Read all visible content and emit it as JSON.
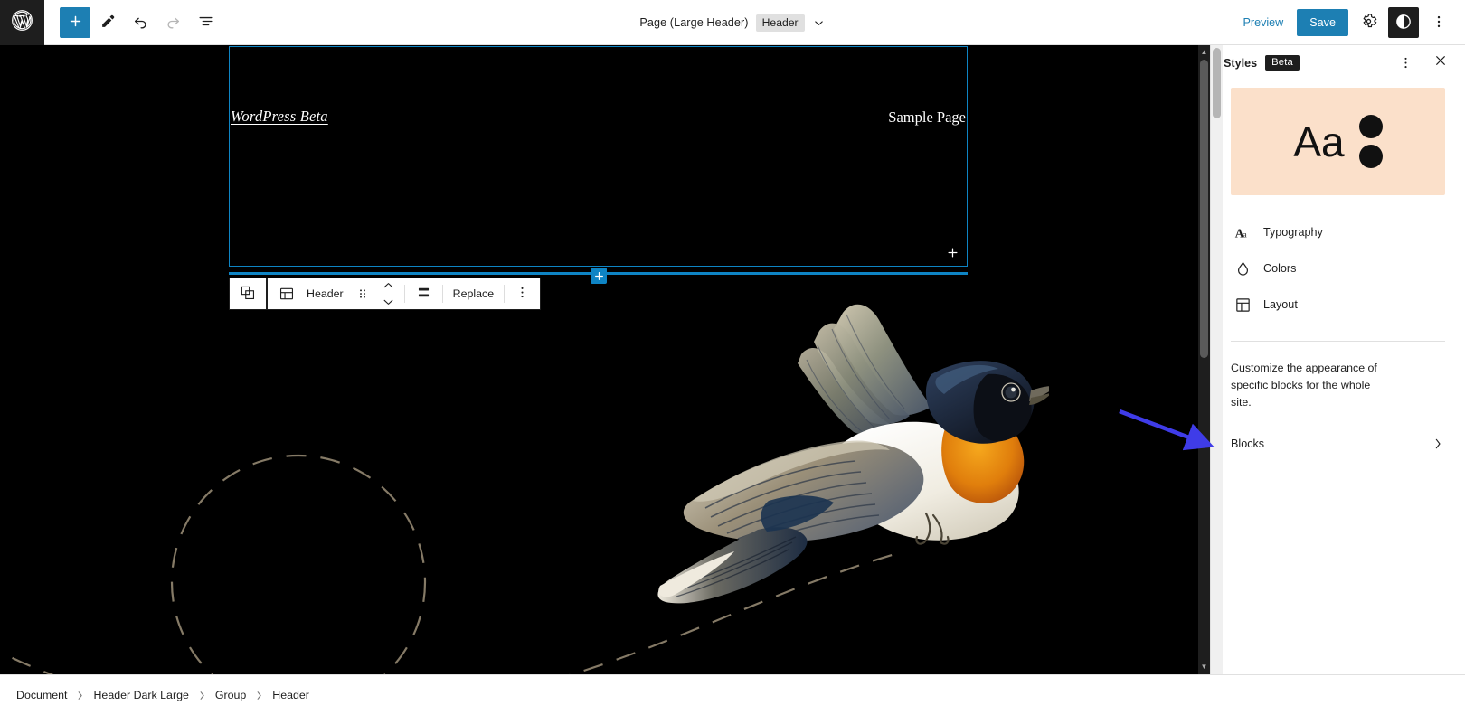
{
  "topbar": {
    "logo_icon": "wordpress-logo-icon",
    "add_block_icon": "plus-icon",
    "edit_icon": "pencil-icon",
    "undo_icon": "undo-arrow-icon",
    "redo_icon": "redo-arrow-icon",
    "list_view_icon": "list-view-icon",
    "document_title": "Page (Large Header)",
    "document_badge": "Header",
    "document_chevron_icon": "chevron-down-icon",
    "preview_label": "Preview",
    "save_label": "Save",
    "settings_icon": "gear-icon",
    "styles_icon": "contrast-half-circle-icon",
    "more_icon": "more-vertical-icon"
  },
  "canvas": {
    "site_title": "WordPress Beta",
    "nav_link": "Sample Page",
    "block_appender_icon": "plus-icon",
    "inserter_icon": "plus-icon",
    "scroll_up_icon": "caret-up-icon",
    "scroll_down_icon": "caret-down-icon"
  },
  "block_toolbar": {
    "parent_block_icon": "select-parent-block-icon",
    "block_type_icon": "header-template-part-icon",
    "block_label": "Header",
    "drag_handle_icon": "drag-dots-icon",
    "move_up_icon": "chevron-up-icon",
    "move_down_icon": "chevron-down-icon",
    "align_icon": "align-vertical-center-icon",
    "replace_label": "Replace",
    "options_icon": "more-vertical-icon"
  },
  "sidebar": {
    "title": "Styles",
    "badge": "Beta",
    "more_icon": "more-vertical-icon",
    "close_icon": "close-x-icon",
    "preview": {
      "sample_text": "Aa",
      "background_color": "#fbe0ca",
      "dot_color": "#111111"
    },
    "menu_items": [
      {
        "label": "Typography",
        "icon": "typography-aa-icon"
      },
      {
        "label": "Colors",
        "icon": "color-droplet-icon"
      },
      {
        "label": "Layout",
        "icon": "layout-grid-icon"
      }
    ],
    "description": "Customize the appearance of specific blocks for the whole site.",
    "blocks_label": "Blocks",
    "blocks_chevron_icon": "chevron-right-icon"
  },
  "annotation": {
    "arrow_color": "#3f3ce8",
    "points_to": "Blocks"
  },
  "breadcrumb": {
    "items": [
      "Document",
      "Header Dark Large",
      "Group",
      "Header"
    ],
    "separator_icon": "chevron-right-icon"
  },
  "colors": {
    "accent_blue": "#1d7fb3",
    "block_outline": "#0e84c4",
    "canvas_background": "#000000",
    "deco_line": "#857a66"
  }
}
